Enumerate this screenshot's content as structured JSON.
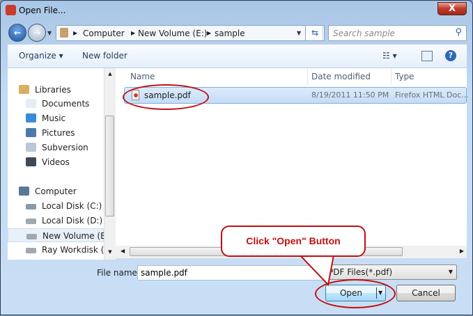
{
  "window": {
    "title": "Open File...",
    "close_label": "X"
  },
  "address": {
    "crumbs": [
      "Computer",
      "New Volume (E:)",
      "sample"
    ]
  },
  "search": {
    "placeholder": "Search sample"
  },
  "toolbar": {
    "organize": "Organize ▾",
    "new_folder": "New folder"
  },
  "nav": {
    "items": [
      {
        "label": "Libraries",
        "icon": "libraries-icon",
        "color": "#d9b060"
      },
      {
        "label": "Documents",
        "icon": "documents-icon",
        "color": "#e6ecf4"
      },
      {
        "label": "Music",
        "icon": "music-icon",
        "color": "#3c8ad8"
      },
      {
        "label": "Pictures",
        "icon": "pictures-icon",
        "color": "#4a7aa8"
      },
      {
        "label": "Subversion",
        "icon": "subversion-icon",
        "color": "#b8c8d8"
      },
      {
        "label": "Videos",
        "icon": "videos-icon",
        "color": "#404858"
      },
      {
        "label": "Computer",
        "icon": "computer-icon",
        "color": "#5a7898"
      },
      {
        "label": "Local Disk (C:)",
        "icon": "drive-icon",
        "color": "#8a98a8"
      },
      {
        "label": "Local Disk (D:)",
        "icon": "drive-icon",
        "color": "#a0a8b0"
      },
      {
        "label": "New Volume (E:)",
        "icon": "drive-icon",
        "color": "#a0a8b0"
      },
      {
        "label": "Ray Workdisk (F:)",
        "icon": "drive-icon",
        "color": "#a0a8b0"
      }
    ]
  },
  "columns": {
    "name": "Name",
    "date": "Date modified",
    "type": "Type"
  },
  "files": [
    {
      "name": "sample.pdf",
      "date": "8/19/2011 11:50 PM",
      "type": "Firefox HTML Doc..."
    }
  ],
  "footer": {
    "file_name_label": "File name:",
    "file_name_value": "sample.pdf",
    "filter": "PDF Files(*.pdf)",
    "open": "Open",
    "cancel": "Cancel"
  },
  "annotation": {
    "callout": "Click \"Open\" Button",
    "color": "#c01010"
  }
}
